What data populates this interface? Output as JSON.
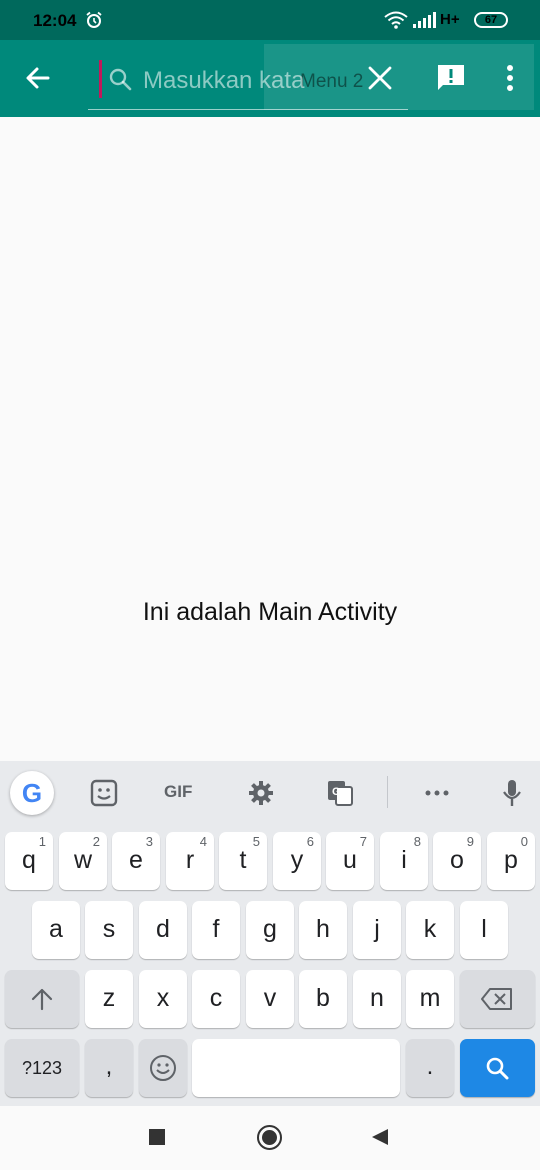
{
  "status_bar": {
    "time": "12:04",
    "network": "H+",
    "battery": "67",
    "icons": [
      "alarm-icon",
      "wifi-icon",
      "signal-icon"
    ]
  },
  "app_bar": {
    "background_color": "#00897b",
    "search_placeholder": "Masukkan kata",
    "menu_overlay_text": "Menu 2",
    "icons": [
      "back-arrow-icon",
      "search-icon",
      "close-icon",
      "feedback-icon",
      "more-vert-icon"
    ]
  },
  "content": {
    "main_text": "Ini adalah Main Activity"
  },
  "keyboard": {
    "toolbar": {
      "google_label": "G",
      "gif_label": "GIF",
      "icons": [
        "sticker-icon",
        "gear-icon",
        "translate-icon",
        "more-horiz-icon",
        "mic-icon"
      ]
    },
    "row1": [
      {
        "key": "q",
        "hint": "1"
      },
      {
        "key": "w",
        "hint": "2"
      },
      {
        "key": "e",
        "hint": "3"
      },
      {
        "key": "r",
        "hint": "4"
      },
      {
        "key": "t",
        "hint": "5"
      },
      {
        "key": "y",
        "hint": "6"
      },
      {
        "key": "u",
        "hint": "7"
      },
      {
        "key": "i",
        "hint": "8"
      },
      {
        "key": "o",
        "hint": "9"
      },
      {
        "key": "p",
        "hint": "0"
      }
    ],
    "row2": [
      "a",
      "s",
      "d",
      "f",
      "g",
      "h",
      "j",
      "k",
      "l"
    ],
    "row3": [
      "z",
      "x",
      "c",
      "v",
      "b",
      "n",
      "m"
    ],
    "symbols_label": "?123",
    "comma_label": ",",
    "period_label": ".",
    "accent_color": "#1e88e5"
  },
  "nav_bar": {
    "icons": [
      "recents-icon",
      "home-icon",
      "back-icon"
    ]
  }
}
